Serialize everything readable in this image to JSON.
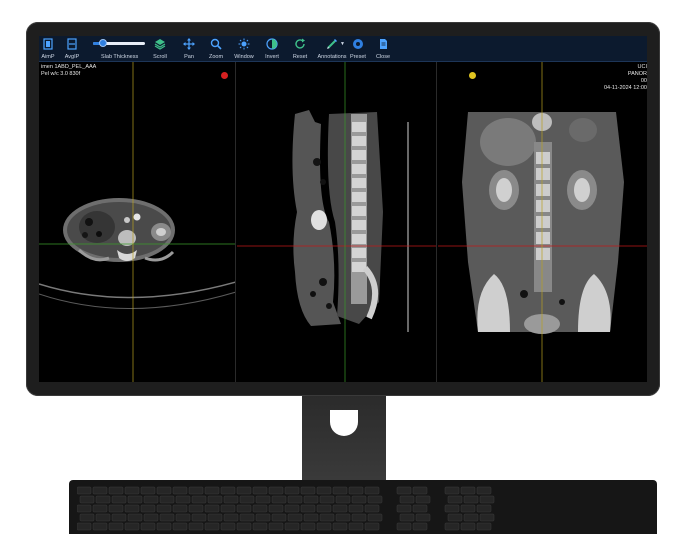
{
  "toolbar": {
    "tools": [
      {
        "label": "AimP",
        "icon": "aimp-icon"
      },
      {
        "label": "AvgIP",
        "icon": "avgip-icon"
      },
      {
        "label": "Scroll",
        "icon": "layers-icon"
      },
      {
        "label": "Pan",
        "icon": "pan-arrows-icon"
      },
      {
        "label": "Zoom",
        "icon": "zoom-magnifier-icon"
      },
      {
        "label": "Window",
        "icon": "sun-icon"
      },
      {
        "label": "Invert",
        "icon": "half-circle-icon"
      },
      {
        "label": "Reset",
        "icon": "refresh-icon"
      },
      {
        "label": "Annotations",
        "icon": "pen-icon"
      },
      {
        "label": "Preset",
        "icon": "preset-icon"
      },
      {
        "label": "Close",
        "icon": "document-icon"
      }
    ],
    "slab": {
      "label": "Slab Thickness",
      "value": 0.2
    }
  },
  "overlay": {
    "top_left_line1": "imen 1ABD_PEL_AAA",
    "top_left_line2": "Pel w/c 3.0 830f",
    "top_right_line1": "UCI",
    "top_right_line2": "PANOR",
    "top_right_line3": "00",
    "top_right_line4": "04-11-2024 12:00"
  },
  "markers": {
    "axial": "#d62020",
    "coronal": "#e0c420"
  },
  "colors": {
    "toolbar_bg": "#0c1a2e",
    "accent": "#2f7fe0",
    "crosshair_red": "#c01818",
    "crosshair_green": "#3a9a2a",
    "crosshair_yellow": "#b8a020"
  }
}
